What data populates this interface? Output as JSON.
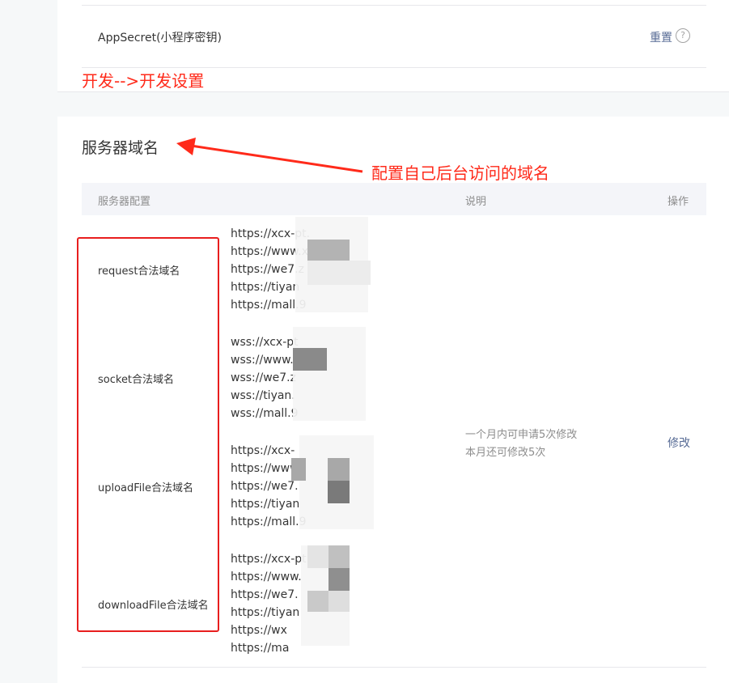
{
  "top_card": {
    "appsecret_label": "AppSecret(小程序密钥)",
    "reset_label": "重置",
    "help_glyph": "?"
  },
  "annotations": {
    "path_note": "开发-->开发设置",
    "domain_note": "配置自己后台访问的域名"
  },
  "server_domains": {
    "title": "服务器域名",
    "columns": {
      "config": "服务器配置",
      "description": "说明",
      "operation": "操作"
    },
    "rows": [
      {
        "label": "request合法域名",
        "urls": [
          "https://xcx-pt.",
          "https://www.xk",
          "https://we7.z",
          "https://tiyan",
          "https://mall.9"
        ]
      },
      {
        "label": "socket合法域名",
        "urls": [
          "wss://xcx-pt",
          "wss://www.",
          "wss://we7.z",
          "wss://tiyan.",
          "wss://mall.9"
        ]
      },
      {
        "label": "uploadFile合法域名",
        "urls": [
          "https://xcx-",
          "https://www",
          "https://we7.",
          "https://tiyan",
          "https://mall.9"
        ]
      },
      {
        "label": "downloadFile合法域名",
        "urls": [
          "https://xcx-pt",
          "https://www.",
          "https://we7.",
          "https://tiyan",
          "https://wx",
          "https://ma"
        ]
      }
    ],
    "description_lines": [
      "一个月内可申请5次修改",
      "本月还可修改5次"
    ],
    "modify_label": "修改"
  },
  "colors": {
    "annotation_red": "#ff2a1a",
    "link_blue": "#576b95",
    "header_bg": "#f4f5f9"
  },
  "icons": [
    "help-icon",
    "red-arrow-icon"
  ]
}
